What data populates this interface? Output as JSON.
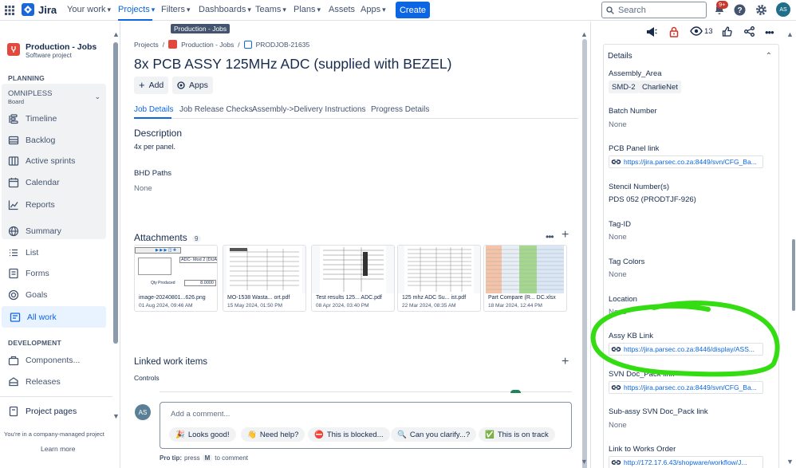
{
  "topnav": {
    "brand": "Jira",
    "items": [
      {
        "label": "Your work",
        "chevron": true
      },
      {
        "label": "Projects",
        "chevron": true,
        "active": true
      },
      {
        "label": "Filters",
        "chevron": true
      },
      {
        "label": "Dashboards",
        "chevron": true
      },
      {
        "label": "Teams",
        "chevron": true
      },
      {
        "label": "Plans",
        "chevron": true
      },
      {
        "label": "Assets",
        "chevron": false
      },
      {
        "label": "Apps",
        "chevron": true
      }
    ],
    "create_label": "Create",
    "search_placeholder": "Search",
    "notifications_badge": "9+",
    "user_initials": "AS",
    "tooltip": "Production - Jobs",
    "accent_color": "#0c66e4"
  },
  "sidebar": {
    "project_name": "Production - Jobs",
    "project_type": "Software project",
    "section_planning": "PLANNING",
    "board_name": "OMNIPLESS",
    "board_sub": "Board",
    "planning_items": [
      "Timeline",
      "Backlog",
      "Active sprints",
      "Calendar",
      "Reports"
    ],
    "items": [
      "Summary",
      "List",
      "Forms",
      "Goals",
      "All work"
    ],
    "section_development": "DEVELOPMENT",
    "dev_items": [
      "Components...",
      "Releases"
    ],
    "project_pages": "Project pages",
    "footer_text": "You're in a company-managed project",
    "learn_more": "Learn more"
  },
  "issue": {
    "breadcrumb": {
      "projects": "Projects",
      "project": "Production - Jobs",
      "key": "PRODJOB-21635"
    },
    "title": "8x PCB ASSY 125MHz ADC (supplied with BEZEL)",
    "add_label": "Add",
    "apps_label": "Apps",
    "tabs": [
      "Job Details",
      "Job Release Checks",
      "Assembly->Delivery Instructions",
      "Progress Details"
    ],
    "description_heading": "Description",
    "description_text": "4x per panel.",
    "bhd_heading": "BHD Paths",
    "bhd_value": "None",
    "attachments_heading": "Attachments",
    "attachments_count": "9",
    "attachments": [
      {
        "name": "image-20240801...626.png",
        "date": "01 Aug 2024, 09:46 AM"
      },
      {
        "name": "MO-1538 Wasta... ort.pdf",
        "date": "15 May 2024, 01:50 PM"
      },
      {
        "name": "Test results 125... ADC.pdf",
        "date": "08 Apr 2024, 03:40 PM"
      },
      {
        "name": "125 mhz ADC Su... ist.pdf",
        "date": "22 Mar 2024, 08:35 AM"
      },
      {
        "name": "Part Compare (R... DC.xlsx",
        "date": "18 Mar 2024, 12:44 PM"
      }
    ],
    "thumb_text": {
      "mod_label": "ADC- Mod 2 (DUAL",
      "qty_label": "Qty Produced",
      "qty_value": "8.0000"
    },
    "linked_heading": "Linked work items",
    "linked_sub": "Controls",
    "comment_placeholder": "Add a comment...",
    "comment_avatar": "AS",
    "quick_replies": [
      {
        "emoji": "🎉",
        "label": "Looks good!"
      },
      {
        "emoji": "👋",
        "label": "Need help?"
      },
      {
        "emoji": "⛔",
        "label": "This is blocked..."
      },
      {
        "emoji": "🔍",
        "label": "Can you clarify...?"
      },
      {
        "emoji": "✅",
        "label": "This is on track"
      }
    ],
    "pro_tip_prefix": "Pro tip:",
    "pro_tip_mid": "press",
    "pro_tip_key": "M",
    "pro_tip_suffix": "to comment"
  },
  "actions": {
    "watch_count": "13"
  },
  "details": {
    "heading": "Details",
    "fields": [
      {
        "label": "Assembly_Area",
        "tags": [
          "SMD-2",
          "CharlieNet"
        ]
      },
      {
        "label": "Batch Number",
        "value": "None"
      },
      {
        "label": "PCB Panel link",
        "link": "https://jira.parsec.co.za:8449/svn/CFG_Ba..."
      },
      {
        "label": "Stencil Number(s)",
        "value": "PDS 052 (PRODTJF-926)",
        "dark": true
      },
      {
        "label": "Tag-ID",
        "value": "None"
      },
      {
        "label": "Tag Colors",
        "value": "None"
      },
      {
        "label": "Location",
        "value": "None"
      },
      {
        "label": "Assy KB Link",
        "link": "https://jira.parsec.co.za:8446/display/ASS..."
      },
      {
        "label": "SVN Doc_Pack link",
        "link": "https://jira.parsec.co.za:8449/svn/CFG_Ba..."
      },
      {
        "label": "Sub-assy SVN Doc_Pack link",
        "value": "None"
      },
      {
        "label": "Link to Works Order",
        "link": "http://172.17.6.43/shopware/workflow/J..."
      }
    ],
    "highlight_color": "#33dd11"
  }
}
